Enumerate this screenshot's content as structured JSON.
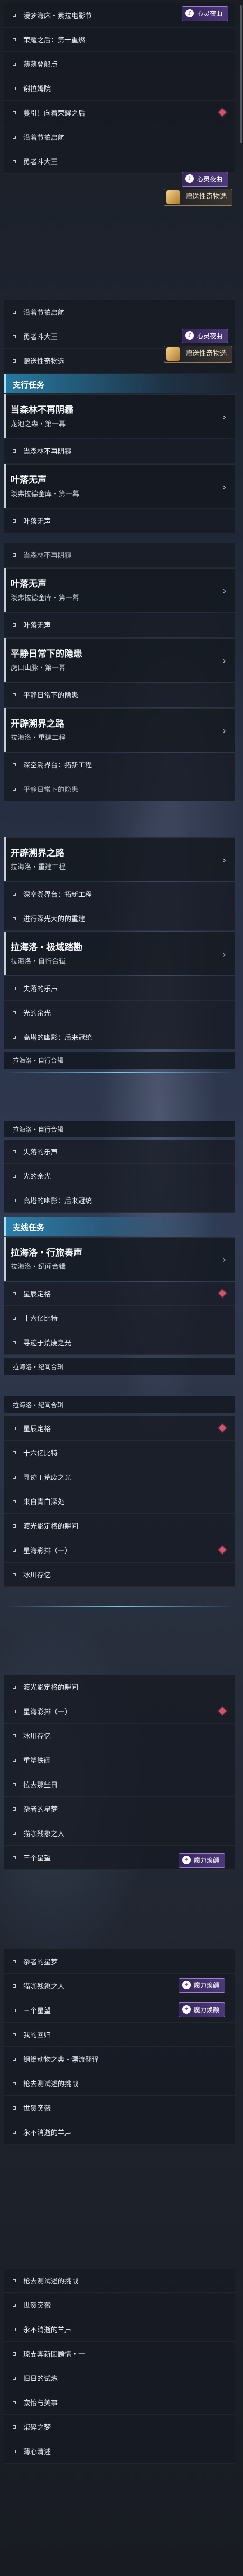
{
  "colors": {
    "marker": "#d9526b",
    "header_accent": "#3aa0d0",
    "badge_purple": "#7b52c0"
  },
  "section1": {
    "items": [
      {
        "label": "漫梦海床・素拉电影节",
        "marker": false
      },
      {
        "label": "荣耀之后：第十重燃",
        "marker": false
      },
      {
        "label": "薄薄登船点",
        "marker": false
      },
      {
        "label": "谢拉姆院",
        "marker": false
      },
      {
        "label": "蔓引！向着荣耀之后",
        "marker": true
      },
      {
        "label": "沿着节拍启航",
        "marker": false
      },
      {
        "label": "勇者斗大王",
        "marker": false
      }
    ],
    "badge_top": "心灵夜曲",
    "badge_bottom": "心灵夜曲",
    "badge_gift": "赠送性奇物选"
  },
  "section2": {
    "items_top": [
      {
        "label": "沿着节拍启航"
      },
      {
        "label": "勇者斗大王"
      },
      {
        "label": "赠送性奇物选"
      }
    ],
    "badge": "心灵夜曲",
    "badge_gift": "赠送性奇物选",
    "header": "支行任务",
    "quests": [
      {
        "title": "当森林不再阴霾",
        "subtitle": "龙池之森・第一幕",
        "child": "当森林不再阴霾"
      },
      {
        "title": "叶落无声",
        "subtitle": "琰弗拉德金库・第一幕",
        "child": "叶落无声"
      }
    ]
  },
  "section3": {
    "items_top": [
      {
        "label": "当森林不再阴霾"
      }
    ],
    "quests": [
      {
        "title": "叶落无声",
        "subtitle": "琰弗拉德金库・第一幕",
        "child": "叶落无声"
      },
      {
        "title": "平静日常下的隐患",
        "subtitle": "虎口山脉・第一幕",
        "child": "平静日常下的隐患"
      },
      {
        "title": "开辟溯界之路",
        "subtitle": "拉海洛・重建工程",
        "child": "深空溯界台：拓新工程"
      }
    ],
    "tail": "平静日常下的隐患"
  },
  "section4": {
    "quests": [
      {
        "title": "开辟溯界之路",
        "subtitle": "拉海洛・重建工程"
      },
      {
        "title": "拉海洛・极域踏勘",
        "subtitle": "拉海洛・自行合辑"
      }
    ],
    "items_mid": [
      {
        "label": "深空溯界台：拓新工程"
      },
      {
        "label": "进行深光大的的重建"
      }
    ],
    "items_bottom": [
      {
        "label": "失落的乐声"
      },
      {
        "label": "光的余光"
      },
      {
        "label": "高塔的幽影：后来冠统"
      }
    ],
    "footer": "拉海洛・自行合辑"
  },
  "section5": {
    "pill_top": "拉海洛・自行合辑",
    "items_top": [
      {
        "label": "失落的乐声"
      },
      {
        "label": "光的余光"
      },
      {
        "label": "高塔的幽影：后来冠统"
      }
    ],
    "header": "支线任务",
    "quest": {
      "title": "拉海洛・行旅奏声",
      "subtitle": "拉海洛・纪闻合辑"
    },
    "items": [
      {
        "label": "星辰定格",
        "marker": true
      },
      {
        "label": "十六亿比特",
        "marker": false
      },
      {
        "label": "寻迹于荒废之光",
        "marker": false
      }
    ],
    "footer": "拉海洛・纪闻合辑"
  },
  "section6": {
    "pill_top": "拉海洛・纪闻合辑",
    "items": [
      {
        "label": "星辰定格",
        "marker": true
      },
      {
        "label": "十六亿比特",
        "marker": false
      },
      {
        "label": "寻迹于荒废之光",
        "marker": false
      },
      {
        "label": "来自青白深处",
        "marker": false
      },
      {
        "label": "渡光影定格的瞬间",
        "marker": false
      },
      {
        "label": "星海彩排（一）",
        "marker": true
      },
      {
        "label": "冰川存忆",
        "marker": false
      }
    ]
  },
  "section7": {
    "items": [
      {
        "label": "渡光影定格的瞬间",
        "marker": false
      },
      {
        "label": "星海彩排（一）",
        "marker": true
      },
      {
        "label": "冰川存忆",
        "marker": false
      },
      {
        "label": "重塑铁阀",
        "marker": false
      },
      {
        "label": "拉去那些日",
        "marker": false
      },
      {
        "label": "杂者的星梦",
        "marker": false
      },
      {
        "label": "猫咖残象之人",
        "marker": false
      },
      {
        "label": "三个星望",
        "marker": false
      }
    ],
    "badge": "魔力焕颜"
  },
  "section8": {
    "items": [
      {
        "label": "杂者的星梦"
      },
      {
        "label": "猫咖残象之人"
      },
      {
        "label": "三个星望"
      },
      {
        "label": "我的回归"
      },
      {
        "label": "钢铝动物之典・漂流翻译"
      },
      {
        "label": "枪去测试述的挑战"
      },
      {
        "label": "世贺突袭"
      },
      {
        "label": "永不消逝的羊声"
      }
    ],
    "badges": [
      "魔力焕颜",
      "魔力焕颜"
    ]
  },
  "section9": {
    "items": [
      {
        "label": "枪去测试述的挑战"
      },
      {
        "label": "世贺突袭"
      },
      {
        "label": "永不消逝的羊声"
      },
      {
        "label": "琼支奔新回顾情・一"
      },
      {
        "label": "旧日的试炼"
      },
      {
        "label": "寂怡与美事"
      },
      {
        "label": "柒碎之梦"
      },
      {
        "label": "薄心清述"
      }
    ]
  }
}
